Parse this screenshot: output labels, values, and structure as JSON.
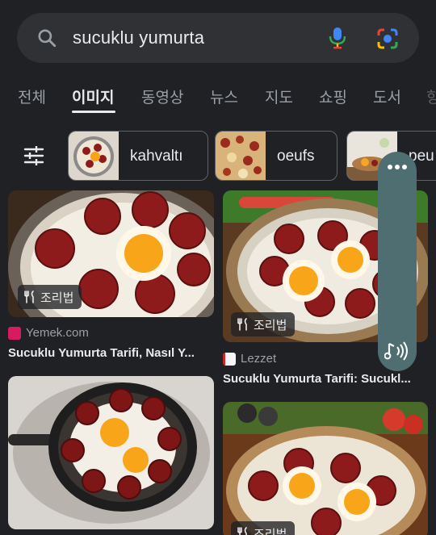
{
  "search": {
    "query": "sucuklu yumurta"
  },
  "tabs": [
    {
      "label": "전체"
    },
    {
      "label": "이미지"
    },
    {
      "label": "동영상"
    },
    {
      "label": "뉴스"
    },
    {
      "label": "지도"
    },
    {
      "label": "쇼핑"
    },
    {
      "label": "도서"
    },
    {
      "label": "항"
    }
  ],
  "active_tab": "이미지",
  "chips": [
    {
      "label": "kahvaltı"
    },
    {
      "label": "oeufs"
    },
    {
      "label": "peu"
    }
  ],
  "results": [
    {
      "badge": "조리법",
      "source": "Yemek.com",
      "title": "Sucuklu Yumurta Tarifi, Nasıl Y..."
    },
    {
      "badge": "조리법",
      "source": "Lezzet",
      "title": "Sucuklu Yumurta Tarifi: Sucukl..."
    },
    {
      "badge": "",
      "source": "",
      "title": ""
    },
    {
      "badge": "조리법",
      "source": "",
      "title": ""
    }
  ],
  "colors": {
    "background": "#202124",
    "search_bg": "#303134",
    "floating_panel": "#4f6e72",
    "yemek_favicon": "#d81b60",
    "lezzet_favicon": "#c62828"
  },
  "icons": [
    "search-icon",
    "mic-icon",
    "lens-icon",
    "tune-icon",
    "utensils-icon",
    "more-icon",
    "audio-icon"
  ]
}
